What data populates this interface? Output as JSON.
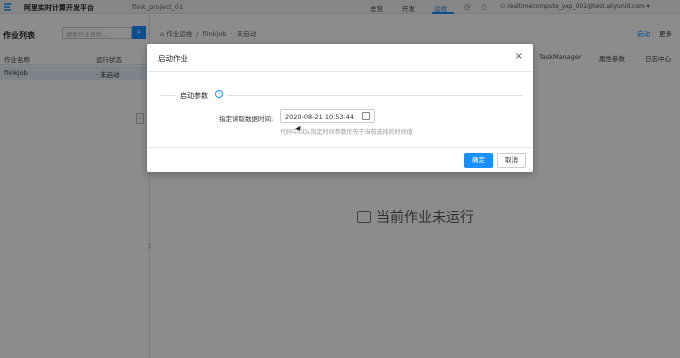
{
  "app": {
    "title": "阿里实时计算开发平台",
    "project": "flink_project_01"
  },
  "nav": {
    "tabs": [
      {
        "label": "总览"
      },
      {
        "label": "开发"
      },
      {
        "label": "运维"
      }
    ],
    "active_tab": "运维",
    "user": "realtimecompute_yxp_001@test.aliyunid.com"
  },
  "sidebar": {
    "title": "作业列表",
    "search_placeholder": "搜索作业名称...",
    "columns": [
      "作业名称",
      "运行状态"
    ],
    "jobs": [
      {
        "name": "flinkjob",
        "status": "未启动"
      }
    ]
  },
  "main": {
    "breadcrumb": [
      "作业运维",
      "flinkjob",
      "未启动"
    ],
    "actions": [
      "启动",
      "更多"
    ],
    "metrics_columns": [
      "TaskManager",
      "属性参数",
      "日志中心"
    ],
    "empty_text": "当前作业未运行"
  },
  "modal": {
    "title": "启动作业",
    "close": "×",
    "section_title": "启动参数",
    "info_icon": "i",
    "field_label": "指定读取数据时间:",
    "date_value": "2020-08-21 10:53:44",
    "hint": "代码中DDL指定时间参数优先于当前选择的时间值",
    "ok_label": "确定",
    "cancel_label": "取消"
  },
  "colors": {
    "primary": "#1890ff",
    "overlay": "rgba(0,0,0,0.45)"
  }
}
